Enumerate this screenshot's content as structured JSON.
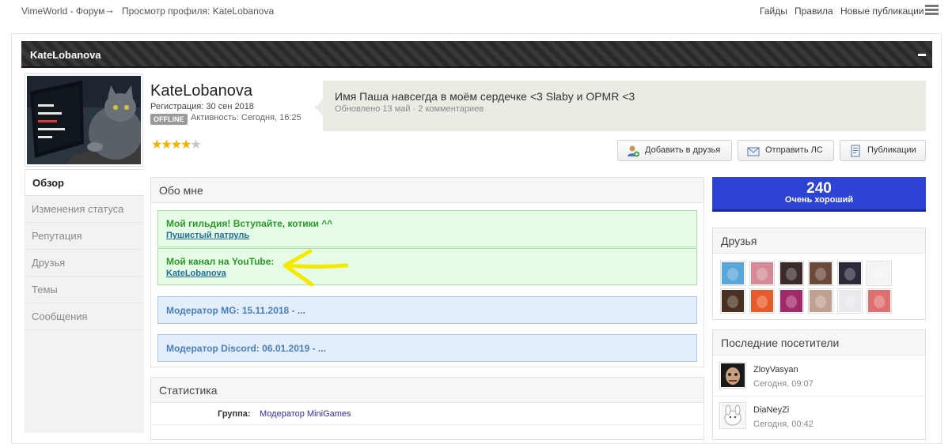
{
  "topbar": {
    "crumb_home": "VimeWorld - Форум",
    "crumb_arrow": "→",
    "crumb_current": "Просмотр профиля: KateLobanova",
    "links": {
      "guides": "Гайды",
      "rules": "Правила",
      "new_posts": "Новые публикации"
    }
  },
  "profile": {
    "header_name": "KateLobanova",
    "username": "KateLobanova",
    "registration": "Регистрация: 30 сен 2018",
    "online_status": "OFFLINE",
    "activity": "Активность: Сегодня, 16:25",
    "rating": {
      "stars_filled": 4,
      "stars_total": 5
    }
  },
  "status": {
    "text": "Имя Паша навсегда в моём сердечке <3 Slaby и OPMR <3",
    "meta": "Обновлено 13 май · 2 комментариев"
  },
  "actions": {
    "add_friend": "Добавить в друзья",
    "send_pm": "Отправить ЛС",
    "posts": "Публикации"
  },
  "nav": {
    "items": [
      {
        "label": "Обзор"
      },
      {
        "label": "Изменения статуса"
      },
      {
        "label": "Репутация"
      },
      {
        "label": "Друзья"
      },
      {
        "label": "Темы"
      },
      {
        "label": "Сообщения"
      }
    ]
  },
  "about": {
    "title": "Обо мне",
    "guild_title": "Мой гильдия! Вступайте, котики ^^",
    "guild_link": "Пушистый патруль",
    "youtube_title": "Мой канал на YouTube:",
    "youtube_link": "KateLobanova",
    "mod_mg": "Модератор MG: 15.11.2018 - ...",
    "mod_discord": "Модератор Discord: 06.01.2019 - ..."
  },
  "stats": {
    "title": "Статистика",
    "group_label": "Группа:",
    "group_value": "Модератор MiniGames"
  },
  "reputation": {
    "value": "240",
    "label": "Очень хороший"
  },
  "friends": {
    "title": "Друзья",
    "avatar_colors": [
      "#5aa6d8",
      "#d58a96",
      "#3a2a2a",
      "#6b4a3a",
      "#2a2a3a",
      "#f4f4f4",
      "#4a3020",
      "#e85a2a",
      "#a02a6a",
      "#c0a090",
      "#e8e8ee",
      "#e07070"
    ]
  },
  "visitors": {
    "title": "Последние посетители",
    "items": [
      {
        "name": "ZloyVasyan",
        "time": "Сегодня, 09:07"
      },
      {
        "name": "DiaNeyZi",
        "time": "Сегодня, 00:42"
      }
    ]
  },
  "colors": {
    "reputation_bg": "#2d43d3",
    "about_green_bg": "#e6fbe6",
    "about_blue_bg": "#e3eefa",
    "header_bg": "#2e2e2e",
    "star": "#f0b400",
    "arrow_annotation": "#f5e900"
  },
  "icons": {
    "add_friend": "user-add-icon",
    "send_pm": "envelope-icon",
    "posts": "document-icon",
    "menu": "menu-icon"
  }
}
